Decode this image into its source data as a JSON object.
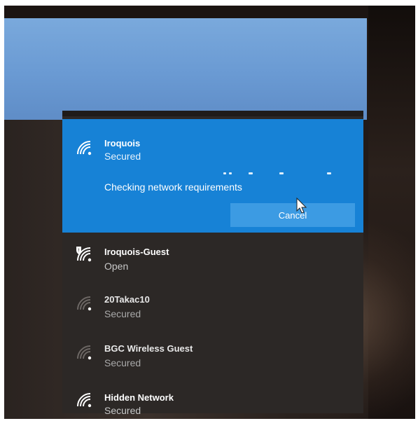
{
  "networks": [
    {
      "name": "Iroquois",
      "status": "Secured",
      "icon": "wifi-secured-icon"
    },
    {
      "name": "Iroquois-Guest",
      "status": "Open",
      "icon": "wifi-open-shield-icon"
    },
    {
      "name": "20Takac10",
      "status": "Secured",
      "icon": "wifi-weak-icon"
    },
    {
      "name": "BGC Wireless Guest",
      "status": "Secured",
      "icon": "wifi-weak-icon"
    },
    {
      "name": "Hidden Network",
      "status": "Secured",
      "icon": "wifi-secured-icon"
    }
  ],
  "active": {
    "checking_text": "Checking network requirements",
    "cancel_label": "Cancel"
  },
  "colors": {
    "accent": "#1782d6",
    "button": "#3c9be3",
    "flyout_bg": "#2c2826"
  }
}
